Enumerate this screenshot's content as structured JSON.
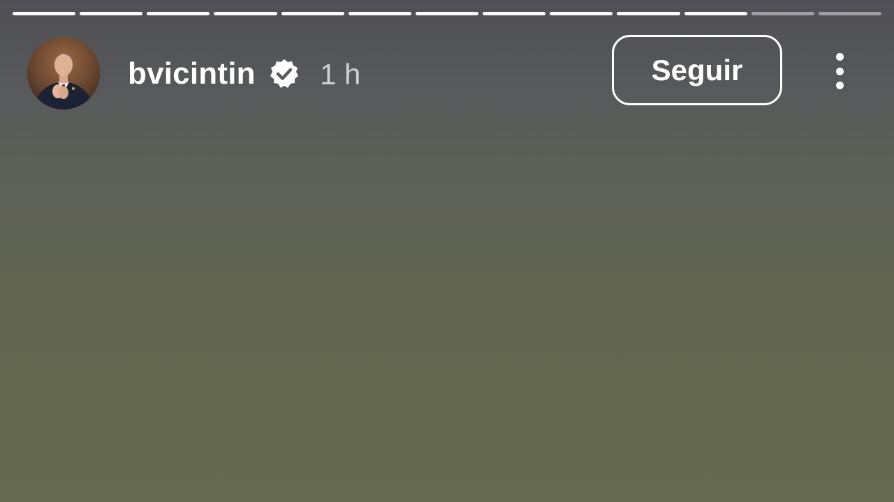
{
  "story": {
    "progress": {
      "total_segments": 13,
      "completed_segments": 11
    },
    "author": {
      "username": "bvicintin",
      "verified": true,
      "avatar_alt": "profile-photo"
    },
    "timestamp": "1 h",
    "follow_label": "Seguir",
    "more_icon": "more-vertical-icon",
    "verified_icon": "verified-badge-icon"
  },
  "colors": {
    "background_top": "#4f4f55",
    "background_bottom": "#65694f",
    "progress_done": "#ffffff",
    "progress_pending": "rgba(255,255,255,0.45)",
    "text": "#ffffff"
  }
}
